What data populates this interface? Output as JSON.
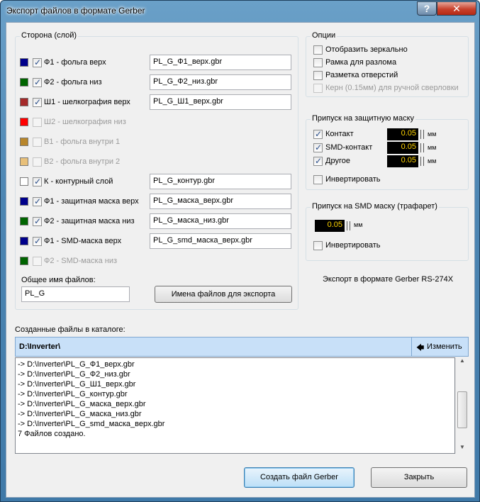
{
  "window": {
    "title": "Экспорт файлов в формате Gerber",
    "help_label": "?",
    "close_label": "✕"
  },
  "layers": {
    "title": "Сторона (слой)",
    "items": [
      {
        "color": "#00008b",
        "checked": true,
        "enabled": true,
        "label": "Ф1 - фольга верх",
        "file": "PL_G_Ф1_верх.gbr"
      },
      {
        "color": "#006400",
        "checked": true,
        "enabled": true,
        "label": "Ф2 - фольга низ",
        "file": "PL_G_Ф2_низ.gbr"
      },
      {
        "color": "#a52a2a",
        "checked": true,
        "enabled": true,
        "label": "Ш1 - шелкография верх",
        "file": "PL_G_Ш1_верх.gbr"
      },
      {
        "color": "#ff0000",
        "checked": false,
        "enabled": false,
        "label": "Ш2 - шелкография низ",
        "file": ""
      },
      {
        "color": "#b8862b",
        "checked": false,
        "enabled": false,
        "label": "В1 - фольга внутри 1",
        "file": ""
      },
      {
        "color": "#e8c07a",
        "checked": false,
        "enabled": false,
        "label": "В2 - фольга внутри 2",
        "file": ""
      },
      {
        "color": "#ffffff",
        "checked": true,
        "enabled": true,
        "label": "К   - контурный слой",
        "file": "PL_G_контур.gbr"
      },
      {
        "color": "#00008b",
        "checked": true,
        "enabled": true,
        "label": "Ф1 - защитная маска верх",
        "file": "PL_G_маска_верх.gbr"
      },
      {
        "color": "#006400",
        "checked": true,
        "enabled": true,
        "label": "Ф2 - защитная маска низ",
        "file": "PL_G_маска_низ.gbr"
      },
      {
        "color": "#00008b",
        "checked": true,
        "enabled": true,
        "label": "Ф1 - SMD-маска верх",
        "file": "PL_G_smd_маска_верх.gbr"
      },
      {
        "color": "#006400",
        "checked": false,
        "enabled": false,
        "label": "Ф2 - SMD-маска низ",
        "file": ""
      }
    ],
    "common_name_label": "Общее имя файлов:",
    "common_name_value": "PL_G",
    "export_names_button": "Имена файлов для экспорта"
  },
  "options": {
    "title": "Опции",
    "items": [
      {
        "label": "Отобразить зеркально",
        "checked": false,
        "enabled": true
      },
      {
        "label": "Рамка для разлома",
        "checked": false,
        "enabled": true
      },
      {
        "label": "Разметка отверстий",
        "checked": false,
        "enabled": true
      },
      {
        "label": "Керн (0.15мм) для ручной сверловки",
        "checked": false,
        "enabled": false
      }
    ]
  },
  "mask_allowance": {
    "title": "Припуск на защитную маску",
    "items": [
      {
        "label": "Контакт",
        "checked": true,
        "value": "0.05",
        "unit": "мм"
      },
      {
        "label": "SMD-контакт",
        "checked": true,
        "value": "0.05",
        "unit": "мм"
      },
      {
        "label": "Другое",
        "checked": true,
        "value": "0.05",
        "unit": "мм"
      }
    ],
    "invert_label": "Инвертировать"
  },
  "smd_allowance": {
    "title": "Припуск на SMD маску (трафарет)",
    "value": "0.05",
    "unit": "мм",
    "invert_label": "Инвертировать"
  },
  "format_note": "Экспорт в формате Gerber RS-274X",
  "output": {
    "label": "Созданные файлы в каталоге:",
    "path": "D:\\Inverter\\",
    "change_button": "Изменить",
    "change_icon": "arrow-left-icon",
    "log": [
      "-> D:\\Inverter\\PL_G_Ф1_верх.gbr",
      "-> D:\\Inverter\\PL_G_Ф2_низ.gbr",
      "-> D:\\Inverter\\PL_G_Ш1_верх.gbr",
      "-> D:\\Inverter\\PL_G_контур.gbr",
      "-> D:\\Inverter\\PL_G_маска_верх.gbr",
      "-> D:\\Inverter\\PL_G_маска_низ.gbr",
      "-> D:\\Inverter\\PL_G_smd_маска_верх.gbr",
      "7 Файлов создано."
    ]
  },
  "footer": {
    "create_button": "Создать файл Gerber",
    "close_button": "Закрыть"
  }
}
